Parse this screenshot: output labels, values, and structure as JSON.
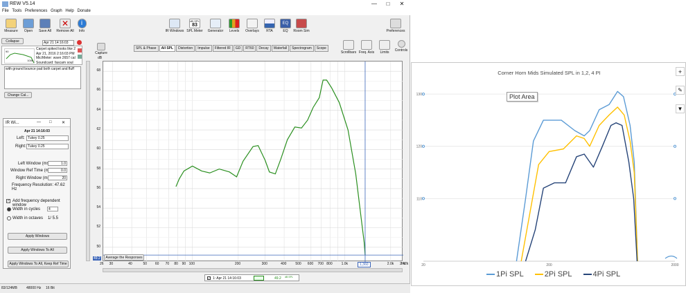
{
  "window": {
    "title": "REW V5.14",
    "minimize": "—",
    "maximize": "□",
    "close": "✕"
  },
  "menu": [
    "File",
    "Tools",
    "Preferences",
    "Graph",
    "Help",
    "Donate"
  ],
  "toolbar_left": [
    "Measure",
    "Open",
    "Save All",
    "Remove All",
    "Info"
  ],
  "toolbar_center": [
    "IR Windows",
    "SPL Meter",
    "Generator",
    "Levels",
    "Overlays",
    "RTA",
    "EQ",
    "Room Sim"
  ],
  "spl_meter_value": "83",
  "spl_meter_tag": "dB SPL",
  "toolbar_right": "Preferences",
  "collapse": "Collapse",
  "measurement": {
    "name": "Apr 21 14:16:03",
    "notes": [
      "Carpet spiked looks like 2",
      "Apr 21, 2016 2:16:03 PM",
      "Mic/Meter: wsen 2657 cal",
      "Soundcard: fascam soul"
    ],
    "note_text": "with ground bounce pad both carpet and fluff",
    "top_tick": "90",
    "bottom_tick": "100k",
    "change_cal": "Change Cal..."
  },
  "capture": "Capture",
  "ylabel": "dB",
  "graph_tabs": [
    "SPL & Phase",
    "All SPL",
    "Distortion",
    "Impulse",
    "Filtered IR",
    "GD",
    "RT60",
    "Decay",
    "Waterfall",
    "Spectrogram",
    "Scope"
  ],
  "graph_tools": [
    "Scrollbars",
    "Freq. Axis",
    "Limits",
    "Controls"
  ],
  "y_ticks": [
    "68",
    "66",
    "64",
    "62",
    "60",
    "58",
    "56",
    "54",
    "52",
    "50"
  ],
  "x_ticks": [
    "26",
    "30",
    "40",
    "50",
    "60",
    "70",
    "80",
    "90",
    "100",
    "200",
    "300",
    "400",
    "500",
    "600",
    "700",
    "800",
    "1.0k",
    "2.0k",
    "2.42k",
    "Hz"
  ],
  "cursor_freq": "1,360",
  "cursor_db": "49.2",
  "avg_btn": "Average the Responses",
  "legend_name": "1: Apr 21 14:16:03",
  "legend_db": "49.2",
  "legend_unit": "dB SPL",
  "ir": {
    "title": "IR Wi...",
    "name": "Apr 21 14:16:03",
    "left_label": "Left:",
    "left_value": "Tukey 0.25",
    "right_label": "Right:",
    "right_value": "Tukey 0.25",
    "left_window_label": "Left Window (ms):",
    "left_window": "1.0",
    "ref_time_label": "Window Ref Time (ms):",
    "ref_time": "0.0",
    "right_window_label": "Right Window (ms):",
    "right_window": "20",
    "freq_res": "Frequency Resolution: 47.62 Hz",
    "add_fdw": "Add frequency dependent window",
    "width_cycles": "Width in cycles",
    "cycles_value": "4",
    "width_octaves": "Width in octaves",
    "octaves_value": "1/ 5.5",
    "apply": "Apply Windows",
    "apply_all": "Apply Windows To All",
    "apply_keep": "Apply Windows To All, Keep Ref Time"
  },
  "status": {
    "memory": "83/124MB",
    "rate": "48000 Hz",
    "bits": "16 Bit"
  },
  "chart_data": {
    "type": "line",
    "title": "Corner Horn Mids Simulated  SPL  in 1,2, 4 PI",
    "tooltip": "Plot Area",
    "y_ticks": [
      "130",
      "120",
      "110"
    ],
    "x_ticks": [
      "20",
      "200",
      "2000"
    ],
    "xscale": "log",
    "ylim": [
      98,
      132
    ],
    "xlim": [
      20,
      2000
    ],
    "legend_position": "bottom",
    "series": [
      {
        "name": "1Pi SPL",
        "color": "#5b9bd5",
        "points": [
          [
            110,
            98
          ],
          [
            130,
            110
          ],
          [
            150,
            121
          ],
          [
            180,
            125
          ],
          [
            250,
            125
          ],
          [
            320,
            123
          ],
          [
            380,
            122
          ],
          [
            420,
            123
          ],
          [
            500,
            127
          ],
          [
            600,
            128
          ],
          [
            700,
            130.5
          ],
          [
            780,
            129.5
          ],
          [
            880,
            124
          ],
          [
            950,
            117
          ],
          [
            1010,
            98
          ]
        ]
      },
      {
        "name": "2Pi SPL",
        "color": "#ffc000",
        "points": [
          [
            120,
            98
          ],
          [
            140,
            107
          ],
          [
            165,
            116.5
          ],
          [
            200,
            119
          ],
          [
            260,
            119.5
          ],
          [
            330,
            122
          ],
          [
            380,
            121.5
          ],
          [
            420,
            120
          ],
          [
            500,
            124
          ],
          [
            600,
            126
          ],
          [
            700,
            127.5
          ],
          [
            790,
            126
          ],
          [
            880,
            121
          ],
          [
            950,
            115
          ],
          [
            1010,
            98
          ]
        ]
      },
      {
        "name": "4Pi SPL",
        "color": "#264478",
        "points": [
          [
            130,
            98
          ],
          [
            155,
            104
          ],
          [
            180,
            112
          ],
          [
            220,
            113
          ],
          [
            270,
            113
          ],
          [
            330,
            118
          ],
          [
            380,
            118.5
          ],
          [
            450,
            116
          ],
          [
            530,
            120
          ],
          [
            620,
            124
          ],
          [
            680,
            124.5
          ],
          [
            760,
            124
          ],
          [
            860,
            117
          ],
          [
            940,
            110
          ],
          [
            1000,
            98
          ]
        ]
      }
    ]
  },
  "rew_chart_data": {
    "type": "line",
    "ylim": [
      48.5,
      69
    ],
    "xscale": "log",
    "xlim": [
      26,
      2420
    ],
    "series": [
      {
        "name": "1: Apr 21 14:16:03",
        "color": "#2a8f1f",
        "points": [
          [
            78,
            56.2
          ],
          [
            82,
            57
          ],
          [
            88,
            57.8
          ],
          [
            100,
            58.3
          ],
          [
            115,
            57.8
          ],
          [
            130,
            57.6
          ],
          [
            150,
            58
          ],
          [
            175,
            57.7
          ],
          [
            195,
            57.2
          ],
          [
            215,
            58.8
          ],
          [
            250,
            60.3
          ],
          [
            270,
            60.4
          ],
          [
            300,
            58.9
          ],
          [
            320,
            57.7
          ],
          [
            350,
            57.5
          ],
          [
            380,
            59
          ],
          [
            420,
            61
          ],
          [
            470,
            62.3
          ],
          [
            520,
            62.2
          ],
          [
            570,
            63
          ],
          [
            620,
            64.3
          ],
          [
            680,
            65.3
          ],
          [
            720,
            67.1
          ],
          [
            760,
            67.1
          ],
          [
            820,
            66.3
          ],
          [
            920,
            64.8
          ],
          [
            1050,
            62
          ],
          [
            1180,
            57.5
          ],
          [
            1280,
            53
          ],
          [
            1340,
            50.5
          ],
          [
            1360,
            49.2
          ]
        ]
      }
    ],
    "cursor_x": 1360
  }
}
